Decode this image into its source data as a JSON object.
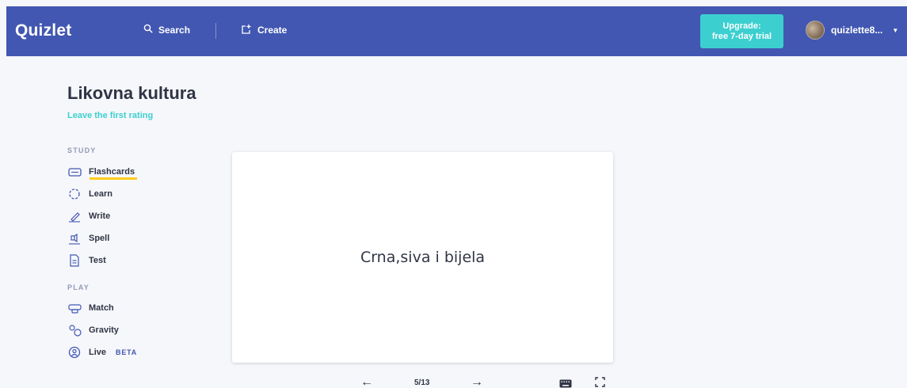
{
  "header": {
    "logo": "Quizlet",
    "search_label": "Search",
    "create_label": "Create",
    "upgrade_label": "Upgrade:\nfree 7-day trial",
    "username": "quizlette8...",
    "colors": {
      "bar": "#4257b2",
      "upgrade": "#3ccfcf"
    }
  },
  "set": {
    "title": "Likovna kultura",
    "rating_link": "Leave the first rating"
  },
  "sidebar": {
    "study_label": "STUDY",
    "study_items": [
      {
        "label": "Flashcards",
        "icon": "flashcards-icon",
        "active": true
      },
      {
        "label": "Learn",
        "icon": "learn-icon"
      },
      {
        "label": "Write",
        "icon": "write-icon"
      },
      {
        "label": "Spell",
        "icon": "spell-icon"
      },
      {
        "label": "Test",
        "icon": "test-icon"
      }
    ],
    "play_label": "PLAY",
    "play_items": [
      {
        "label": "Match",
        "icon": "match-icon"
      },
      {
        "label": "Gravity",
        "icon": "gravity-icon"
      },
      {
        "label": "Live",
        "icon": "live-icon",
        "badge": "BETA"
      }
    ]
  },
  "card": {
    "text": "Crna,siva i bijela"
  },
  "controls": {
    "counter": "5/13",
    "prev_icon": "arrow-left-icon",
    "next_icon": "arrow-right-icon",
    "keyboard_icon": "keyboard-icon",
    "fullscreen_icon": "fullscreen-icon"
  }
}
